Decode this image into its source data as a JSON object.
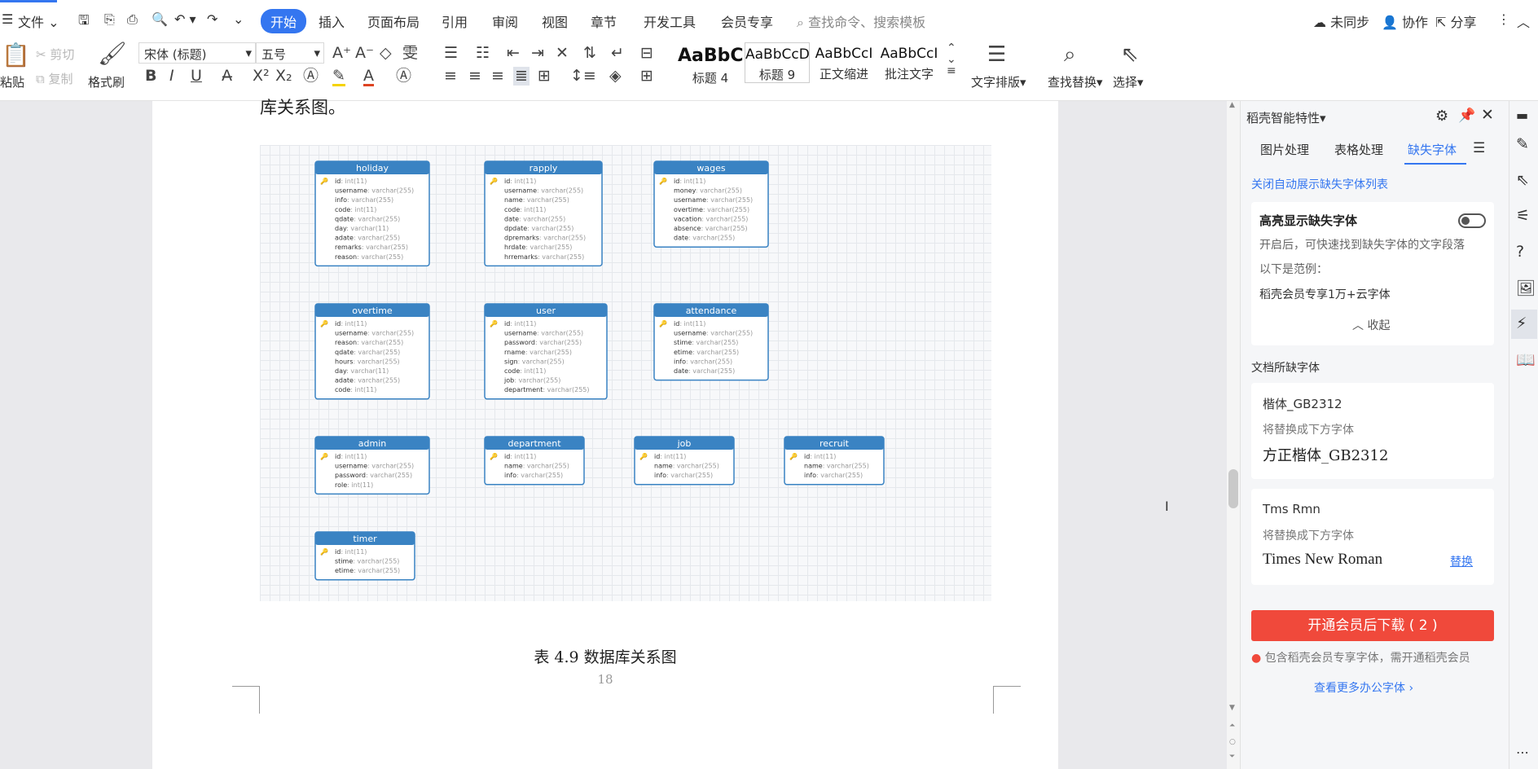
{
  "menubar": {
    "file": "文件",
    "tabs": [
      "开始",
      "插入",
      "页面布局",
      "引用",
      "审阅",
      "视图",
      "章节",
      "开发工具",
      "会员专享"
    ],
    "search_placeholder": "查找命令、搜索模板",
    "sync": "未同步",
    "collab": "协作",
    "share": "分享"
  },
  "ribbon": {
    "paste": "粘贴",
    "cut": "剪切",
    "copy": "复制",
    "format_painter": "格式刷",
    "font": "宋体 (标题)",
    "size": "五号",
    "styles": [
      {
        "preview": "AaBbC",
        "label": "标题 4"
      },
      {
        "preview": "AaBbCcDd",
        "label": "标题 9"
      },
      {
        "preview": "AaBbCcI",
        "label": "正文缩进"
      },
      {
        "preview": "AaBbCcI",
        "label": "批注文字"
      }
    ],
    "text_layout": "文字排版",
    "find_replace": "查找替换",
    "select": "选择"
  },
  "document": {
    "top_text": "库关系图。",
    "caption": "表 4.9  数据库关系图",
    "page_number": "18"
  },
  "erd": {
    "tables": [
      {
        "name": "holiday",
        "fields": [
          [
            "id",
            "int(11)"
          ],
          [
            "username",
            "varchar(255)"
          ],
          [
            "info",
            "varchar(255)"
          ],
          [
            "code",
            "int(11)"
          ],
          [
            "qdate",
            "varchar(255)"
          ],
          [
            "day",
            "varchar(11)"
          ],
          [
            "adate",
            "varchar(255)"
          ],
          [
            "remarks",
            "varchar(255)"
          ],
          [
            "reason",
            "varchar(255)"
          ]
        ]
      },
      {
        "name": "rapply",
        "fields": [
          [
            "id",
            "int(11)"
          ],
          [
            "username",
            "varchar(255)"
          ],
          [
            "name",
            "varchar(255)"
          ],
          [
            "code",
            "int(11)"
          ],
          [
            "date",
            "varchar(255)"
          ],
          [
            "dpdate",
            "varchar(255)"
          ],
          [
            "dpremarks",
            "varchar(255)"
          ],
          [
            "hrdate",
            "varchar(255)"
          ],
          [
            "hrremarks",
            "varchar(255)"
          ]
        ]
      },
      {
        "name": "wages",
        "fields": [
          [
            "id",
            "int(11)"
          ],
          [
            "money",
            "varchar(255)"
          ],
          [
            "username",
            "varchar(255)"
          ],
          [
            "overtime",
            "varchar(255)"
          ],
          [
            "vacation",
            "varchar(255)"
          ],
          [
            "absence",
            "varchar(255)"
          ],
          [
            "date",
            "varchar(255)"
          ]
        ]
      },
      {
        "name": "overtime",
        "fields": [
          [
            "id",
            "int(11)"
          ],
          [
            "username",
            "varchar(255)"
          ],
          [
            "reason",
            "varchar(255)"
          ],
          [
            "qdate",
            "varchar(255)"
          ],
          [
            "hours",
            "varchar(255)"
          ],
          [
            "day",
            "varchar(11)"
          ],
          [
            "adate",
            "varchar(255)"
          ],
          [
            "code",
            "int(11)"
          ]
        ]
      },
      {
        "name": "user",
        "fields": [
          [
            "id",
            "int(11)"
          ],
          [
            "username",
            "varchar(255)"
          ],
          [
            "password",
            "varchar(255)"
          ],
          [
            "rname",
            "varchar(255)"
          ],
          [
            "sign",
            "varchar(255)"
          ],
          [
            "code",
            "int(11)"
          ],
          [
            "job",
            "varchar(255)"
          ],
          [
            "department",
            "varchar(255)"
          ]
        ]
      },
      {
        "name": "attendance",
        "fields": [
          [
            "id",
            "int(11)"
          ],
          [
            "username",
            "varchar(255)"
          ],
          [
            "stime",
            "varchar(255)"
          ],
          [
            "etime",
            "varchar(255)"
          ],
          [
            "info",
            "varchar(255)"
          ],
          [
            "date",
            "varchar(255)"
          ]
        ]
      },
      {
        "name": "admin",
        "fields": [
          [
            "id",
            "int(11)"
          ],
          [
            "username",
            "varchar(255)"
          ],
          [
            "password",
            "varchar(255)"
          ],
          [
            "role",
            "int(11)"
          ]
        ]
      },
      {
        "name": "department",
        "fields": [
          [
            "id",
            "int(11)"
          ],
          [
            "name",
            "varchar(255)"
          ],
          [
            "info",
            "varchar(255)"
          ]
        ]
      },
      {
        "name": "job",
        "fields": [
          [
            "id",
            "int(11)"
          ],
          [
            "name",
            "varchar(255)"
          ],
          [
            "info",
            "varchar(255)"
          ]
        ]
      },
      {
        "name": "recruit",
        "fields": [
          [
            "id",
            "int(11)"
          ],
          [
            "name",
            "varchar(255)"
          ],
          [
            "info",
            "varchar(255)"
          ]
        ]
      },
      {
        "name": "timer",
        "fields": [
          [
            "id",
            "int(11)"
          ],
          [
            "stime",
            "varchar(255)"
          ],
          [
            "etime",
            "varchar(255)"
          ]
        ]
      }
    ]
  },
  "panel": {
    "title": "稻壳智能特性",
    "tabs": [
      "图片处理",
      "表格处理",
      "缺失字体"
    ],
    "close_auto": "关闭自动展示缺失字体列表",
    "highlight_title": "高亮显示缺失字体",
    "highlight_desc": "开启后，可快速找到缺失字体的文字段落",
    "example_label": "以下是范例：",
    "example_text": "稻壳会员专享1万+云字体",
    "collapse": "收起",
    "missing_header": "文档所缺字体",
    "font1_name": "楷体_GB2312",
    "replace_label": "将替换成下方字体",
    "font1_replacement": "方正楷体_GB2312",
    "font2_name": "Tms Rmn",
    "font2_replacement": "Times New Roman",
    "replace_link": "替换",
    "download_button": "开通会员后下载 ( 2 )",
    "member_note": "包含稻壳会员专享字体，需开通稻壳会员",
    "more_fonts": "查看更多办公字体"
  },
  "colors": {
    "accent": "#3476f0",
    "table_header": "#3a83c3",
    "download": "#f0493b"
  }
}
